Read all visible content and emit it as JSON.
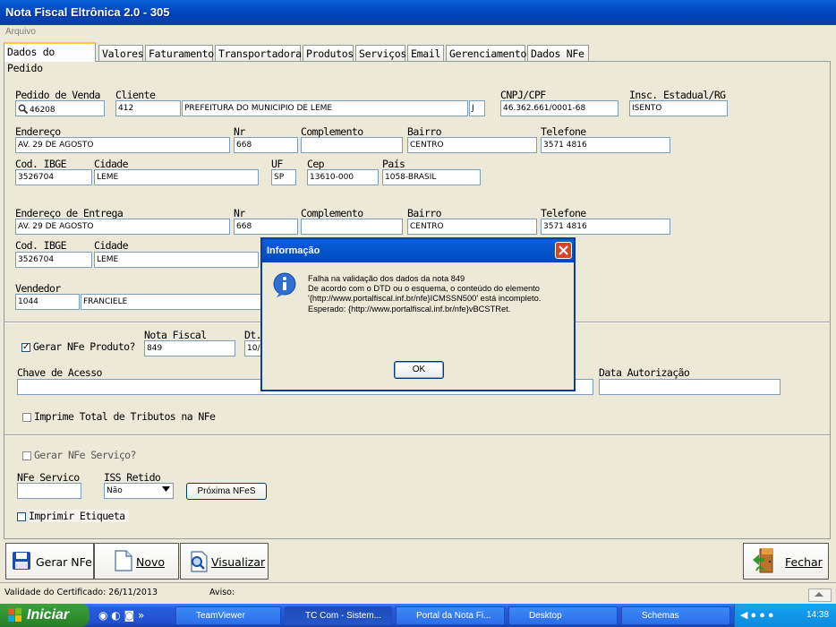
{
  "window": {
    "title": "Nota Fiscal Eltrônica 2.0 - 305",
    "menu": "Arquivo"
  },
  "tabs": [
    "Dados do Pedido",
    "Valores",
    "Faturamento",
    "Transportadora",
    "Produtos",
    "Serviços",
    "Email",
    "Gerenciamento",
    "Dados NFe"
  ],
  "pedido": {
    "pedido_label": "Pedido de Venda",
    "pedido_value": "46208",
    "cliente_label": "Cliente",
    "cliente_code": "412",
    "cliente_name": "PREFEITURA DO MUNICIPIO  DE LEME",
    "cliente_type": "J",
    "cnpj_label": "CNPJ/CPF",
    "cnpj_value": "46.362.661/0001-68",
    "ie_label": "Insc. Estadual/RG",
    "ie_value": "ISENTO",
    "endereco_label": "Endereço",
    "endereco_value": "AV. 29 DE AGOSTO",
    "nr_label": "Nr",
    "nr_value": "668",
    "complemento_label": "Complemento",
    "complemento_value": "",
    "bairro_label": "Bairro",
    "bairro_value": "CENTRO",
    "telefone_label": "Telefone",
    "telefone_value": "3571 4816",
    "ibge_label": "Cod. IBGE",
    "ibge_value": "3526704",
    "cidade_label": "Cidade",
    "cidade_value": "LEME",
    "uf_label": "UF",
    "uf_value": "SP",
    "cep_label": "Cep",
    "cep_value": "13610-000",
    "pais_label": "País",
    "pais_value": "1058-BRASIL",
    "entrega_label": "Endereço de Entrega",
    "entrega_value": "AV. 29 DE AGOSTO",
    "entrega_nr_label": "Nr",
    "entrega_nr_value": "668",
    "entrega_complemento_label": "Complemento",
    "entrega_complemento_value": "",
    "entrega_bairro_label": "Bairro",
    "entrega_bairro_value": "CENTRO",
    "entrega_telefone_label": "Telefone",
    "entrega_telefone_value": "3571 4816",
    "entrega_ibge_label": "Cod. IBGE",
    "entrega_ibge_value": "3526704",
    "entrega_cidade_label": "Cidade",
    "entrega_cidade_value": "LEME",
    "vendedor_label": "Vendedor",
    "vendedor_code": "1044",
    "vendedor_name": "FRANCIELE"
  },
  "nfe": {
    "gerar_produto_label": "Gerar NFe Produto?",
    "gerar_produto_checked": true,
    "nota_label": "Nota Fiscal",
    "nota_value": "849",
    "dt_label": "Dt.",
    "dt_value": "10/",
    "chave_label": "Chave de Acesso",
    "chave_value": "",
    "data_autorizacao_label": "Data Autorização",
    "data_autorizacao_value": "",
    "imprime_tributos_label": "Imprime Total de Tributos na NFe",
    "imprime_tributos_checked": false,
    "gerar_servico_label": "Gerar NFe Serviço?",
    "gerar_servico_checked": false,
    "nfe_servico_label": "NFe Servico",
    "nfe_servico_value": "",
    "iss_label": "ISS Retido",
    "iss_value": "Não",
    "proxima_label": "Próxima NFeS",
    "imprimir_etiqueta_label": "Imprimir Etiqueta",
    "imprimir_etiqueta_checked": false
  },
  "actions": {
    "gerar": "Gerar NFe",
    "novo": "Novo",
    "visualizar": "Visualizar",
    "fechar": "Fechar"
  },
  "status": {
    "certificado": "Validade do Certificado: 26/11/2013",
    "aviso": "Aviso:"
  },
  "dialog": {
    "title": "Informação",
    "lines": [
      "Falha na validação dos dados da nota 849",
      "De acordo com o DTD ou o esquema, o conteúdo do elemento",
      "'{http://www.portalfiscal.inf.br/nfe}ICMSSN500' está incompleto.",
      "Esperado: {http://www.portalfiscal.inf.br/nfe}vBCSTRet."
    ],
    "ok": "OK"
  },
  "taskbar": {
    "start": "Iniciar",
    "items": [
      "TeamViewer",
      "TC Com - Sistem...",
      "Portal da Nota Fi...",
      "Desktop",
      "Schemas"
    ],
    "clock": "14:38"
  },
  "colors": {
    "title_blue": "#0A5FD8",
    "start_green": "#2F8F2F",
    "close_red": "#D7442B",
    "tab_highlight": "#FFC83C"
  }
}
